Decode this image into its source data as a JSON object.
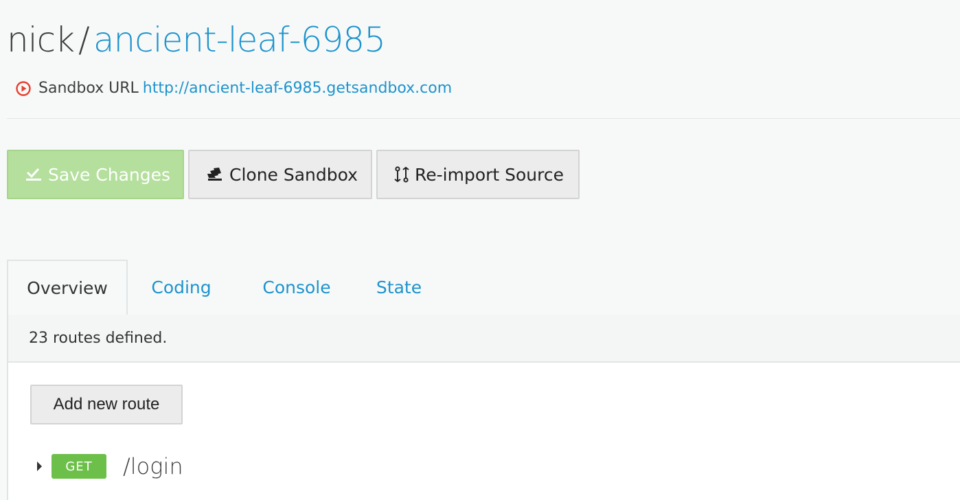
{
  "header": {
    "owner": "nick",
    "separator": "/",
    "sandbox_name": "ancient-leaf-6985"
  },
  "sandbox_url": {
    "icon": "play-circle-icon",
    "label": "Sandbox URL",
    "url": "http://ancient-leaf-6985.getsandbox.com"
  },
  "toolbar": {
    "save_label": "Save Changes",
    "save_icon": "check-tray-icon",
    "clone_label": "Clone Sandbox",
    "clone_icon": "clone-icon",
    "reimport_label": "Re-import Source",
    "reimport_icon": "git-compare-icon"
  },
  "tabs": [
    {
      "label": "Overview",
      "active": true
    },
    {
      "label": "Coding",
      "active": false
    },
    {
      "label": "Console",
      "active": false
    },
    {
      "label": "State",
      "active": false
    }
  ],
  "overview": {
    "routes_summary": "23 routes defined.",
    "add_route_label": "Add new route",
    "routes": [
      {
        "method": "GET",
        "path": "/login"
      }
    ]
  },
  "colors": {
    "link": "#1e93cc",
    "save_button_bg": "#b4df9d",
    "get_badge": "#6cc04a",
    "url_icon": "#e8402f"
  }
}
